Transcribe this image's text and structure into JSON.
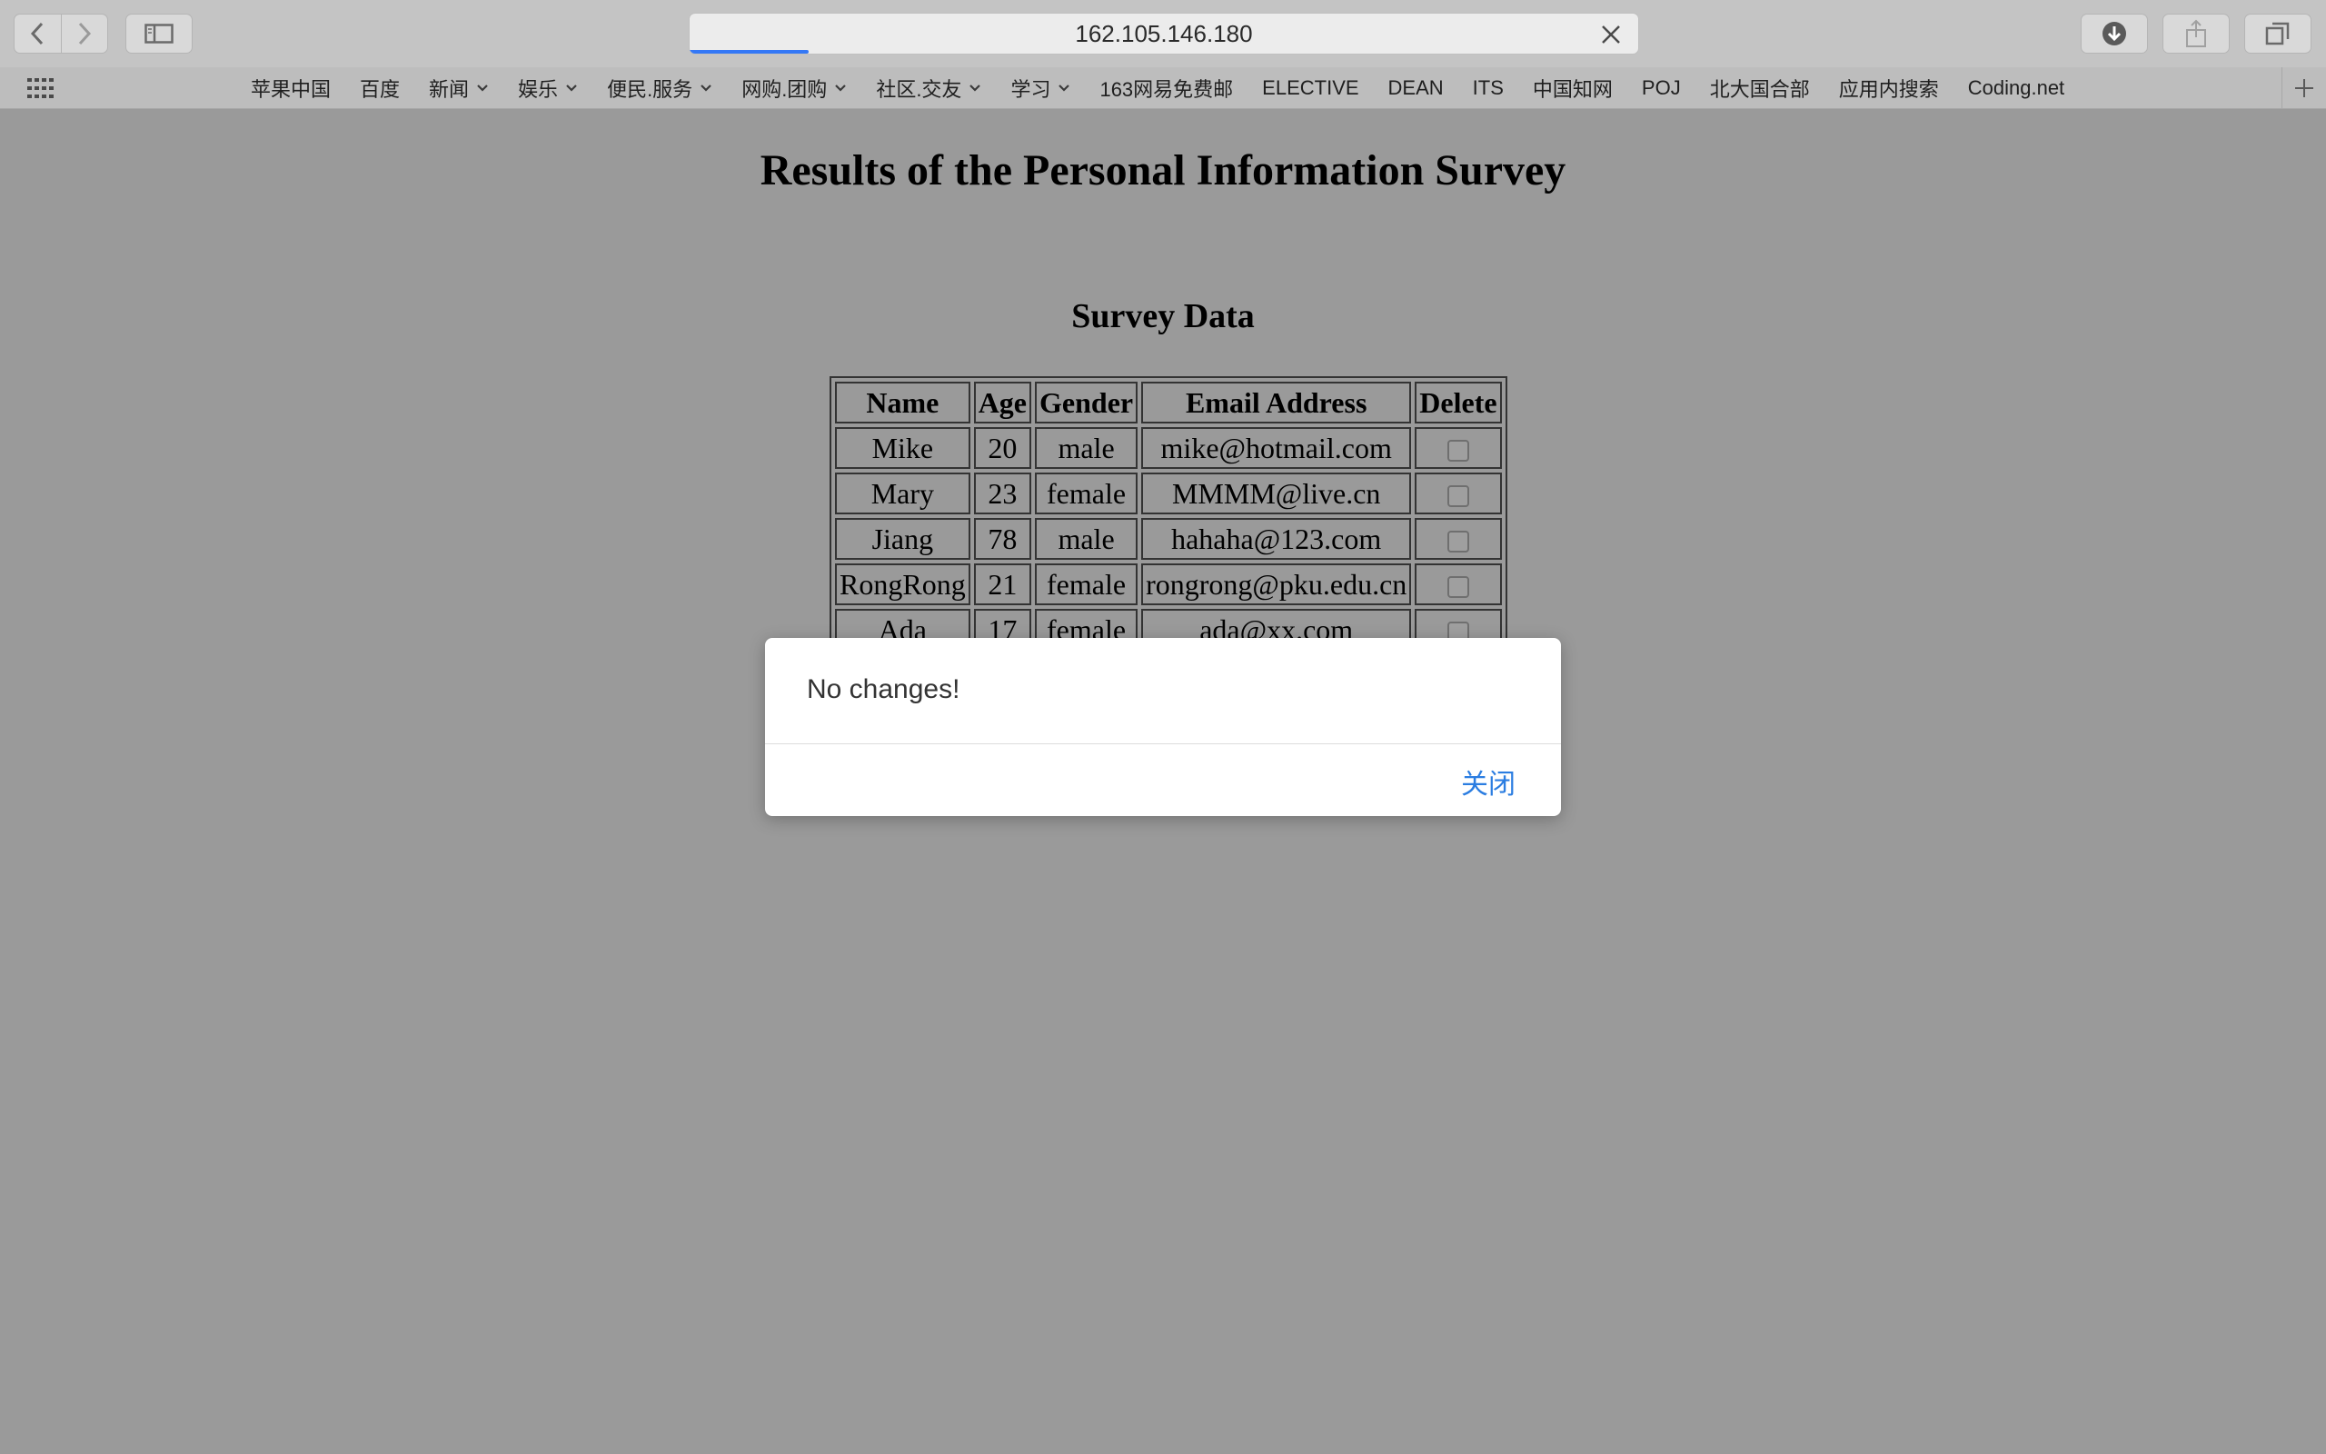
{
  "browser": {
    "url": "162.105.146.180",
    "load_progress": 0.125,
    "bookmarks": [
      {
        "label": "苹果中国",
        "has_menu": false
      },
      {
        "label": "百度",
        "has_menu": false
      },
      {
        "label": "新闻",
        "has_menu": true
      },
      {
        "label": "娱乐",
        "has_menu": true
      },
      {
        "label": "便民.服务",
        "has_menu": true
      },
      {
        "label": "网购.团购",
        "has_menu": true
      },
      {
        "label": "社区.交友",
        "has_menu": true
      },
      {
        "label": "学习",
        "has_menu": true
      },
      {
        "label": "163网易免费邮",
        "has_menu": false
      },
      {
        "label": "ELECTIVE",
        "has_menu": false
      },
      {
        "label": "DEAN",
        "has_menu": false
      },
      {
        "label": "ITS",
        "has_menu": false
      },
      {
        "label": "中国知网",
        "has_menu": false
      },
      {
        "label": "POJ",
        "has_menu": false
      },
      {
        "label": "北大国合部",
        "has_menu": false
      },
      {
        "label": "应用内搜索",
        "has_menu": false
      },
      {
        "label": "Coding.net",
        "has_menu": false
      }
    ]
  },
  "page": {
    "title": "Results of the Personal Information Survey",
    "section_title": "Survey Data",
    "table": {
      "headers": [
        "Name",
        "Age",
        "Gender",
        "Email Address",
        "Delete"
      ],
      "rows": [
        {
          "name": "Mike",
          "age": "20",
          "gender": "male",
          "email": "mike@hotmail.com",
          "delete": false
        },
        {
          "name": "Mary",
          "age": "23",
          "gender": "female",
          "email": "MMMM@live.cn",
          "delete": false
        },
        {
          "name": "Jiang",
          "age": "78",
          "gender": "male",
          "email": "hahaha@123.com",
          "delete": false
        },
        {
          "name": "RongRong",
          "age": "21",
          "gender": "female",
          "email": "rongrong@pku.edu.cn",
          "delete": false
        },
        {
          "name": "Ada",
          "age": "17",
          "gender": "female",
          "email": "ada@xx.com",
          "delete": false
        }
      ]
    }
  },
  "dialog": {
    "message": "No changes!",
    "close_label": "关闭"
  },
  "colors": {
    "accent": "#3478f6",
    "dialog_button": "#2b7de1",
    "page_overlay": "#9a9a9a"
  }
}
